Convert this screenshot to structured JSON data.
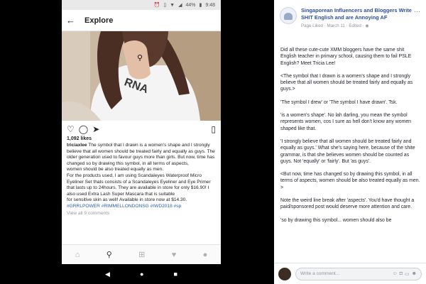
{
  "phone": {
    "status": {
      "battery": "44%",
      "time": "9:48",
      "icons": [
        "alarm-icon",
        "vibrate-icon",
        "wifi-icon",
        "signal-icon",
        "battery-icon"
      ]
    },
    "appbar": {
      "back_icon": "arrow-left-icon",
      "title": "Explore"
    },
    "post": {
      "likes": "1,092 likes",
      "username": "triciaxlee",
      "caption_lines": [
        " The symbol that I drawn is a women's shape and I strongly believe that all women should be treated fairly and equally as guys. The older generation used to favour guys more than girls. But now, time has changed so by drawing this symbol, in all terms of aspects,",
        " women should be also treated equally as men.",
        "For the products used, I am using Scandaleyes Waterproof Micro Eyeliner Set thats consists of a Scandaleyes Eyeliner and Eye Primer that lasts up to 24hours. They are available in store for only $16.90! I also used Extra Lash Super Mascara that is suitable",
        " for sensitive skin as well! Available in store now at $14.30."
      ],
      "hashtags": "#GRRLPOWER #RIMMELLONDONSG #IWD2018 #sp",
      "view_all": "View all 9 comments",
      "action_icons": [
        "heart-icon",
        "comment-icon",
        "share-icon",
        "bookmark-icon"
      ]
    },
    "tabs": [
      "home-icon",
      "search-icon",
      "add-post-icon",
      "activity-heart-icon",
      "profile-icon"
    ],
    "sysnav": [
      "back-triangle-icon",
      "home-circle-icon",
      "recents-square-icon"
    ]
  },
  "fb": {
    "title": "Singaporean Influencers and Bloggers Write SHIT English and are Annoying AF",
    "meta": "Page Liked · March 11 · Edited · ",
    "paragraphs": [
      "Did all these cute-cute XMM bloggers have the same shit English teacher in primary school, causing them to fail PSLE English? Meet Tricia Lee!",
      "<The symbol that I drawn is a women's shape and I strongly believe that all women should be treated fairly and equally as guys.>",
      "'The symbol I drew' or 'The symbol I have drawn'. Tsk.",
      "'is a women's shape'. No lah darling, you mean the symbol represents women, cos I sure as hell don't know any women shaped like that.",
      "'I strongly believe that all women should be treated fairly and equally as guys.' What she's saying here, because of the shite grammar, is that she believes women should be counted as guys. Not 'equally' or 'fairly'. But 'as guys'.",
      "<But now, time has changed so by drawing this symbol, in all terms of aspects, women should be also treated equally as men. >",
      "Note the weird line break after 'aspects'. You'd have thought a paid/sponsored post would deserve more attention and care.",
      "'so by drawing this symbol... women should also be"
    ],
    "comment_placeholder": "Write a comment..."
  }
}
